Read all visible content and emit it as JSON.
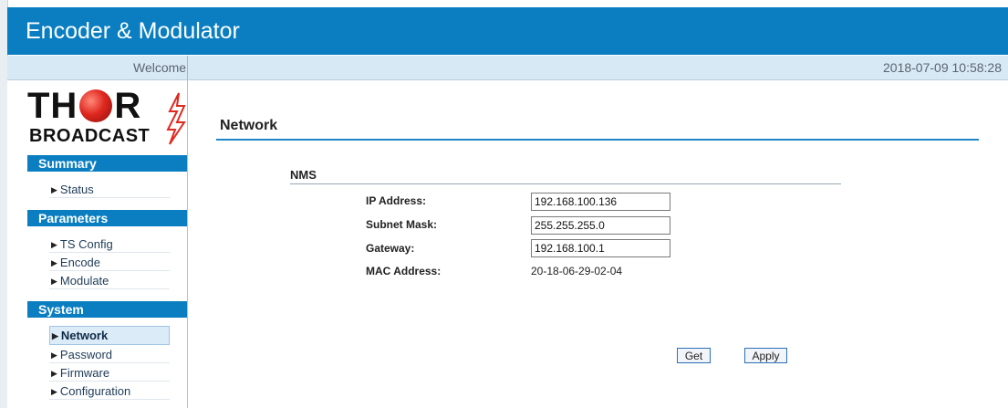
{
  "header": {
    "title": "Encoder & Modulator"
  },
  "welcome_bar": {
    "welcome_text": "Welcome",
    "datetime": "2018-07-09 10:58:28"
  },
  "logo": {
    "top": "THOR",
    "bottom": "BROADCAST"
  },
  "sidebar": {
    "sections": [
      {
        "title": "Summary",
        "items": [
          "Status"
        ]
      },
      {
        "title": "Parameters",
        "items": [
          "TS Config",
          "Encode",
          "Modulate"
        ]
      },
      {
        "title": "System",
        "items": [
          "Network",
          "Password",
          "Firmware",
          "Configuration"
        ]
      }
    ],
    "active_item": "Network"
  },
  "page": {
    "title": "Network",
    "nms": {
      "title": "NMS",
      "ip_label": "IP Address:",
      "ip_value": "192.168.100.136",
      "subnet_label": "Subnet Mask:",
      "subnet_value": "255.255.255.0",
      "gateway_label": "Gateway:",
      "gateway_value": "192.168.100.1",
      "mac_label": "MAC Address:",
      "mac_value": "20-18-06-29-02-04"
    },
    "buttons": {
      "get_label": "Get",
      "apply_label": "Apply"
    }
  },
  "colors": {
    "header_blue": "#0a7ec0",
    "welcome_bg": "#d8e9f6",
    "logo_red": "#e0281f"
  },
  "icons": {
    "nav_marker": "triangle-right-icon",
    "logo_bolt": "lightning-bolt-icon",
    "logo_globe": "globe-icon"
  }
}
